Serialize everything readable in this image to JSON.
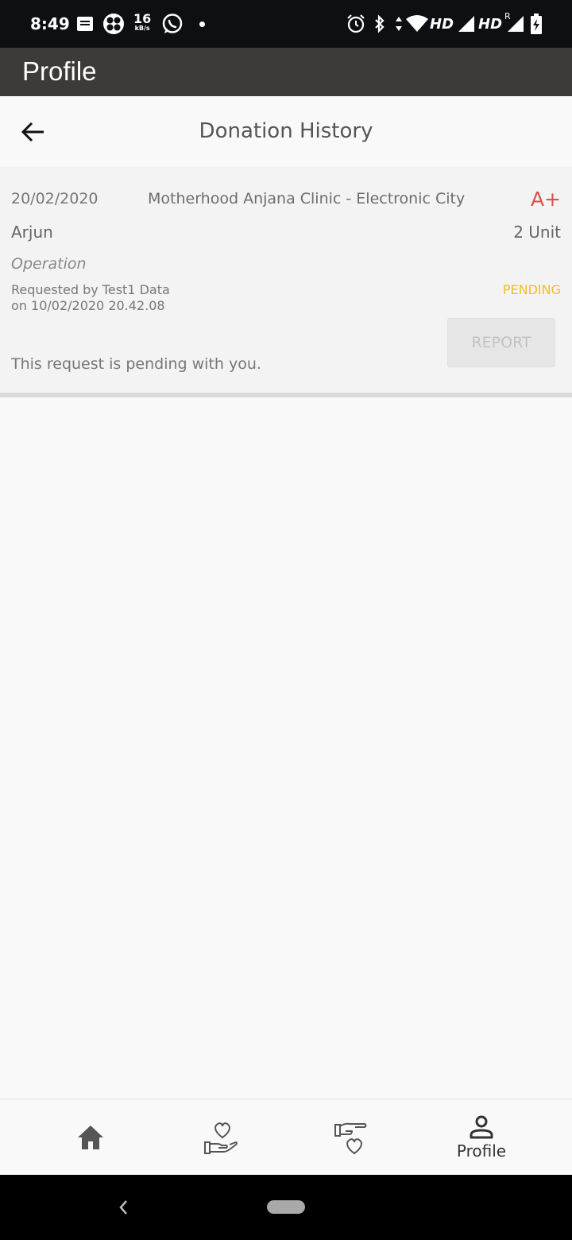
{
  "status_bar": {
    "time": "8:49",
    "speed_value": "16",
    "speed_unit": "kB/s",
    "network_1": "HD",
    "network_2": "HD",
    "roaming": "R"
  },
  "app_bar": {
    "title": "Profile"
  },
  "sub_header": {
    "title": "Donation History"
  },
  "donation": {
    "date": "20/02/2020",
    "place": "Motherhood Anjana Clinic - Electronic City",
    "blood_group": "A+",
    "blood_group_color": "#d9534f",
    "name": "Arjun",
    "units": "2 Unit",
    "purpose": "Operation",
    "requested_by": "Requested by Test1 Data",
    "requested_on": "on 10/02/2020 20.42.08",
    "status": "PENDING",
    "status_color": "#f0c020",
    "report_label": "REPORT",
    "note": "This request is pending with you."
  },
  "bottom_nav": {
    "items": [
      {
        "icon": "home-icon",
        "label": ""
      },
      {
        "icon": "donate-heart-icon",
        "label": ""
      },
      {
        "icon": "request-heart-icon",
        "label": ""
      },
      {
        "icon": "profile-icon",
        "label": "Profile"
      }
    ]
  }
}
